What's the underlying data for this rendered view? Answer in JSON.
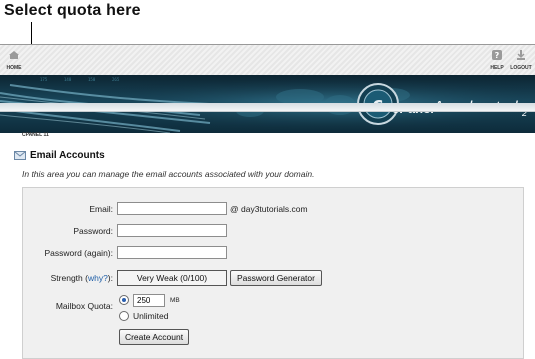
{
  "callout": {
    "text": "Select quota here"
  },
  "nav": {
    "home": "HOME",
    "help": "HELP",
    "logout": "LOGOUT"
  },
  "banner": {
    "logo_text": "cPanel",
    "accelerated": "Accelerated",
    "version": "2"
  },
  "breadcrumb": "CPANEL 11",
  "section": {
    "title": "Email Accounts",
    "description": "In this area you can manage the email accounts associated with your domain."
  },
  "form": {
    "email_label": "Email:",
    "email_value": "",
    "domain_suffix": "@ day3tutorials.com",
    "password_label": "Password:",
    "password_again_label": "Password (again):",
    "strength_label_prefix": "Strength (",
    "strength_link": "why?",
    "strength_label_suffix": "):",
    "strength_value": "Very Weak (0/100)",
    "password_generator": "Password Generator",
    "quota_label": "Mailbox Quota:",
    "quota_value": "250",
    "quota_unit": "MB",
    "unlimited_label": "Unlimited",
    "create_button": "Create Account"
  },
  "colors": {
    "link": "#1f5fa8",
    "banner_dark": "#0c2431",
    "banner_mid": "#19475c"
  }
}
